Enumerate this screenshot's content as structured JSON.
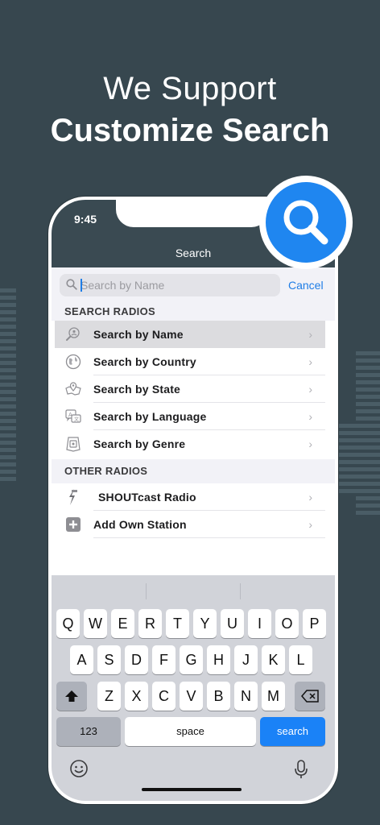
{
  "headline": {
    "line1": "We Support",
    "line2": "Customize Search"
  },
  "status": {
    "time": "9:45"
  },
  "nav": {
    "title": "Search"
  },
  "search": {
    "placeholder": "Search by Name",
    "cancel_label": "Cancel"
  },
  "sections": {
    "search_radios": "SEARCH RADIOS",
    "other_radios": "OTHER RADIOS"
  },
  "search_items": [
    {
      "label": "Search by Name",
      "icon": "search-name-icon",
      "selected": true
    },
    {
      "label": "Search by Country",
      "icon": "globe-icon"
    },
    {
      "label": "Search by State",
      "icon": "map-pin-icon"
    },
    {
      "label": "Search by Language",
      "icon": "language-icon"
    },
    {
      "label": "Search by Genre",
      "icon": "genre-icon"
    }
  ],
  "other_items": [
    {
      "label": "SHOUTcast Radio",
      "icon": "shoutcast-icon"
    },
    {
      "label": "Add Own Station",
      "icon": "plus-icon"
    }
  ],
  "keyboard": {
    "row1": [
      "Q",
      "W",
      "E",
      "R",
      "T",
      "Y",
      "U",
      "I",
      "O",
      "P"
    ],
    "row2": [
      "A",
      "S",
      "D",
      "F",
      "G",
      "H",
      "J",
      "K",
      "L"
    ],
    "row3": [
      "Z",
      "X",
      "C",
      "V",
      "B",
      "N",
      "M"
    ],
    "numbers_label": "123",
    "space_label": "space",
    "search_label": "search"
  },
  "colors": {
    "background": "#37474f",
    "accent": "#1a82f7",
    "navbar": "#3a4a52"
  }
}
